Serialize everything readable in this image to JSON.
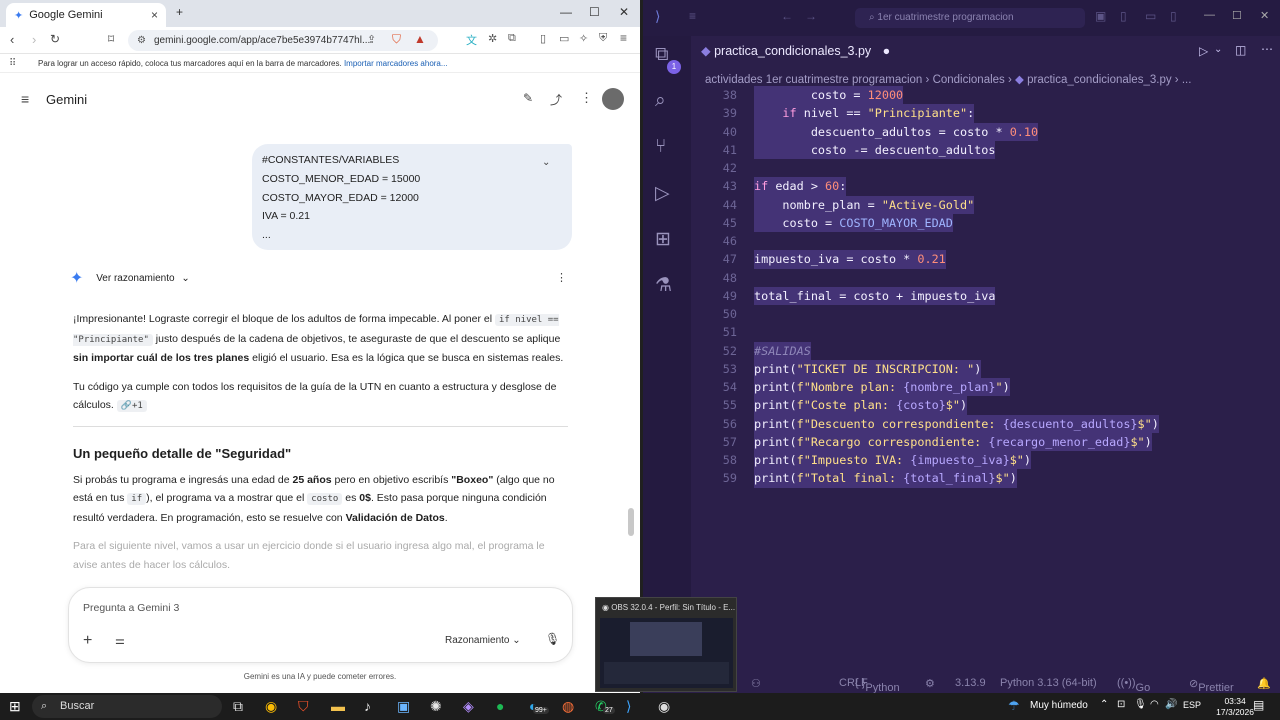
{
  "browser": {
    "tab_title": "Google Gemini",
    "url": "gemini.google.com/app/ace7be5e3974b7747hl...",
    "bookmarks_hint": "Para lograr un acceso rápido, coloca tus marcadores aquí en la barra de marcadores.",
    "bookmarks_link": "Importar marcadores ahora..."
  },
  "gemini": {
    "title": "Gemini",
    "prompt_lines": [
      "#CONSTANTES/VARIABLES",
      "COSTO_MENOR_EDAD = 15000",
      "COSTO_MAYOR_EDAD = 12000",
      "IVA = 0.21",
      "..."
    ],
    "reasoning_label": "Ver razonamiento",
    "p1_a": "¡Impresionante! Lograste corregir el bloque de los adultos de forma impecable. Al poner el ",
    "p1_code": "if nivel == \"Principiante\"",
    "p1_b": " justo después de la cadena de objetivos, te aseguraste de que el descuento se aplique ",
    "p1_bold1": "sin importar cuál de los tres planes",
    "p1_c": " eligió el usuario. Esa es la lógica que se busca en sistemas reales.",
    "p2": "Tu código ya cumple con todos los requisitos de la guía de la UTN en cuanto a estructura y desglose de cálculos.",
    "p2_chip": "+1",
    "heading": "Un pequeño detalle de \"Seguridad\"",
    "p3_a": "Si probás tu programa e ingresás una edad de ",
    "p3_b1": "25 años",
    "p3_b": " pero en objetivo escribís ",
    "p3_b2": "\"Boxeo\"",
    "p3_c": " (algo que no está en tus ",
    "p3_code1": "if",
    "p3_d": "), el programa va a mostrar que el ",
    "p3_code2": "costo",
    "p3_e": " es ",
    "p3_b3": "0$",
    "p3_f": ". Esto pasa porque ninguna condición resultó verdadera. En programación, esto se resuelve con ",
    "p3_b4": "Validación de Datos",
    "p3_g": ".",
    "p4": "Para el siguiente nivel, vamos a usar un ejercicio donde si el usuario ingresa algo mal, el programa le avise antes de hacer los cálculos.",
    "input_placeholder": "Pregunta a Gemini 3",
    "mode_label": "Razonamiento",
    "disclaimer": "Gemini es una IA y puede cometer errores."
  },
  "editor": {
    "search": "1er cuatrimestre programacion",
    "file_tab": "practica_condicionales_3.py",
    "breadcrumb": [
      "actividades 1er cuatrimestre programacion",
      "Condicionales",
      "practica_condicionales_3.py",
      "..."
    ],
    "lines": [
      {
        "n": "38",
        "t": "        costo = 12000"
      },
      {
        "n": "39",
        "t": "    if nivel == \"Principiante\":"
      },
      {
        "n": "40",
        "t": "        descuento_adultos = costo * 0.10"
      },
      {
        "n": "41",
        "t": "        costo -= descuento_adultos"
      },
      {
        "n": "42",
        "t": ""
      },
      {
        "n": "43",
        "t": "if edad > 60:"
      },
      {
        "n": "44",
        "t": "    nombre_plan = \"Active-Gold\""
      },
      {
        "n": "45",
        "t": "    costo = COSTO_MAYOR_EDAD"
      },
      {
        "n": "46",
        "t": ""
      },
      {
        "n": "47",
        "t": "impuesto_iva = costo * 0.21"
      },
      {
        "n": "48",
        "t": ""
      },
      {
        "n": "49",
        "t": "total_final = costo + impuesto_iva"
      },
      {
        "n": "50",
        "t": ""
      },
      {
        "n": "51",
        "t": ""
      },
      {
        "n": "52",
        "t": "#SALIDAS"
      },
      {
        "n": "53",
        "t": "print(\"TICKET DE INSCRIPCION: \")"
      },
      {
        "n": "54",
        "t": "print(f\"Nombre plan: {nombre_plan}\")"
      },
      {
        "n": "55",
        "t": "print(f\"Coste plan: {costo}$\")"
      },
      {
        "n": "56",
        "t": "print(f\"Descuento correspondiente: {descuento_adultos}$\")"
      },
      {
        "n": "57",
        "t": "print(f\"Recargo correspondiente: {recargo_menor_edad}$\")"
      },
      {
        "n": "58",
        "t": "print(f\"Impuesto IVA: {impuesto_iva}$\")"
      },
      {
        "n": "59",
        "t": "print(f\"Total final: {total_final}$\")"
      }
    ],
    "status": {
      "eol": "CRLF",
      "lang": "Python",
      "version": "3.13.9",
      "interpreter": "Python 3.13 (64-bit)",
      "golive": "Go Live",
      "prettier": "Prettier"
    },
    "badge": "1"
  },
  "obs_preview_title": "OBS 32.0.4 - Perfil: Sin Título - E...",
  "taskbar": {
    "search": "Buscar",
    "weather": "Muy húmedo",
    "lang": "ESP",
    "time": "03:34",
    "date": "17/3/2026",
    "badge_edge": "99+",
    "badge_whatsapp": "27"
  }
}
